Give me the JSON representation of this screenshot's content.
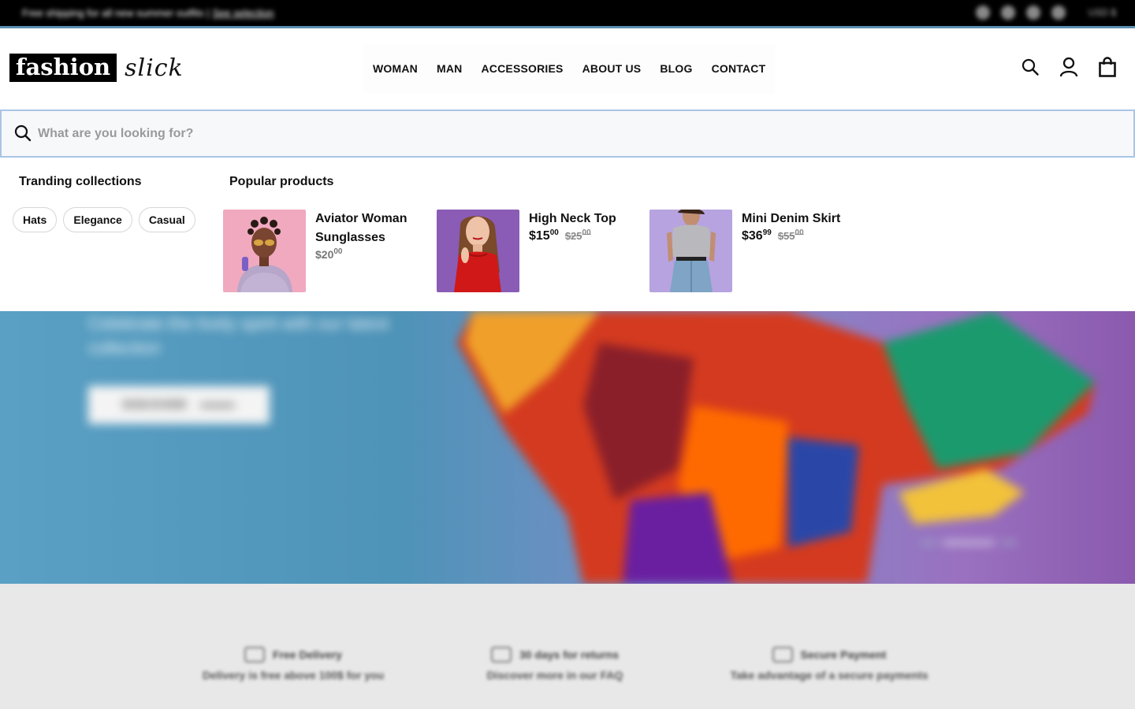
{
  "topbar": {
    "announcement": "Free shipping for all new summer outfits |",
    "announcement_link": "See selection",
    "currency": "USD $"
  },
  "logo": {
    "boxed": "fashion",
    "script": "slick"
  },
  "nav": {
    "items": [
      "WOMAN",
      "MAN",
      "ACCESSORIES",
      "ABOUT US",
      "BLOG",
      "CONTACT"
    ]
  },
  "header_icons": [
    "search-icon",
    "account-icon",
    "cart-icon"
  ],
  "search": {
    "placeholder": "What are you looking for?",
    "value": ""
  },
  "trending": {
    "title": "Tranding collections",
    "chips": [
      "Hats",
      "Elegance",
      "Casual"
    ]
  },
  "popular": {
    "title": "Popular products",
    "products": [
      {
        "name": "Aviator Woman Sunglasses",
        "price_main": "$20",
        "price_cents": "00",
        "old_main": "",
        "old_cents": ""
      },
      {
        "name": "High Neck Top",
        "price_main": "$15",
        "price_cents": "00",
        "old_main": "$25",
        "old_cents": "00"
      },
      {
        "name": "Mini Denim Skirt",
        "price_main": "$36",
        "price_cents": "99",
        "old_main": "$55",
        "old_cents": "00"
      }
    ]
  },
  "hero": {
    "subtitle": "Celebrate the lively spirit with our latest collection",
    "cta": "DISCOVER"
  },
  "features": [
    {
      "title": "Free Delivery",
      "desc": "Delivery is free above 100$ for you"
    },
    {
      "title": "30 days for returns",
      "desc": "Discover more in our FAQ"
    },
    {
      "title": "Secure Payment",
      "desc": "Take advantage of a secure payments"
    }
  ],
  "colors": {
    "accent_border": "#a9c5e6",
    "topbar": "#000000"
  }
}
